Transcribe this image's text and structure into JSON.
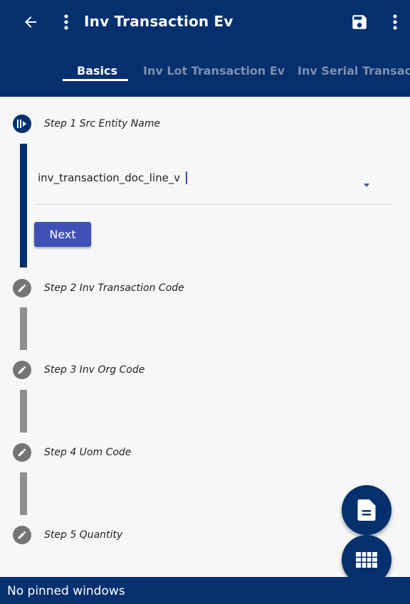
{
  "colors": {
    "primary": "#05306e",
    "accent": "#3f51b5",
    "tab_inactive": "#7f8fae",
    "step_inactive": "#757575"
  },
  "header": {
    "title": "Inv Transaction Ev",
    "back_icon": "arrow-back-icon",
    "menu_icon": "more-vert-icon",
    "save_icon": "save-icon",
    "overflow_icon": "more-vert-icon"
  },
  "tabs": [
    {
      "label": "Basics",
      "active": true
    },
    {
      "label": "Inv Lot Transaction Ev",
      "active": false
    },
    {
      "label": "Inv Serial Transact",
      "active": false
    }
  ],
  "steps": [
    {
      "label": "Step 1 Src Entity Name",
      "state": "active",
      "icon": "step-active-icon"
    },
    {
      "label": "Step 2 Inv Transaction Code",
      "state": "editable",
      "icon": "pencil-icon"
    },
    {
      "label": "Step 3 Inv Org Code",
      "state": "editable",
      "icon": "pencil-icon"
    },
    {
      "label": "Step 4 Uom Code",
      "state": "editable",
      "icon": "pencil-icon"
    },
    {
      "label": "Step 5 Quantity",
      "state": "editable",
      "icon": "pencil-icon"
    }
  ],
  "step1_field": {
    "value": "inv_transaction_doc_line_v"
  },
  "next_button": {
    "label": "Next"
  },
  "fabs": [
    {
      "icon": "document-icon"
    },
    {
      "icon": "grid-icon"
    }
  ],
  "bottom_bar": {
    "text": "No pinned windows"
  }
}
